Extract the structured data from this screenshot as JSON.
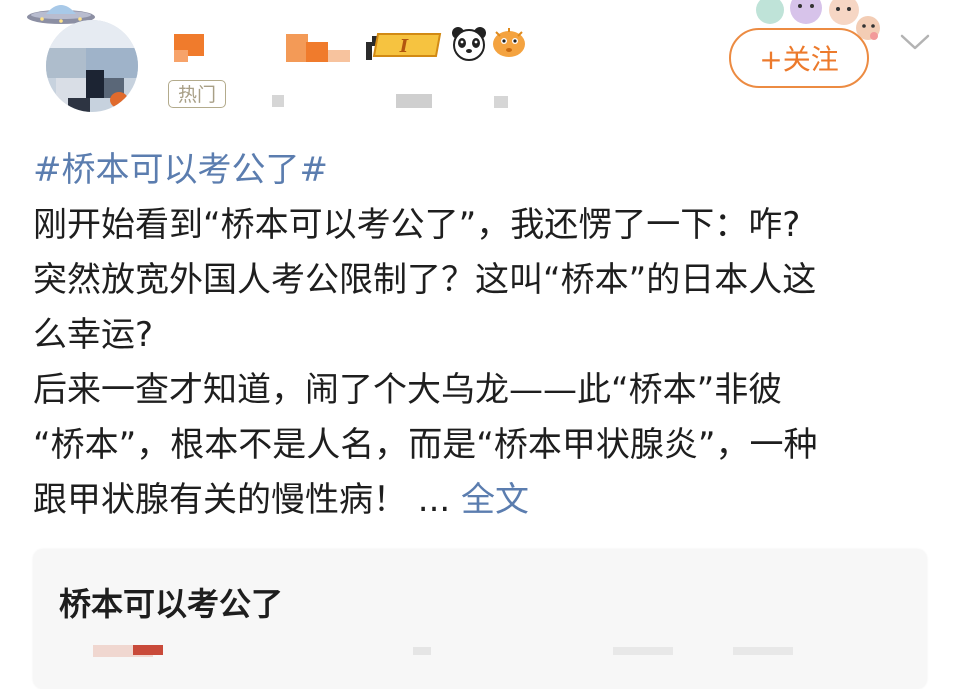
{
  "header": {
    "hot_tag": "热门",
    "follow_label": "+关注",
    "vip_badge_text": "I",
    "icons": {
      "ufo": "ufo-decoration-icon",
      "vip": "vip-level-badge-icon",
      "panda": "panda-icon",
      "fish": "pufferfish-icon",
      "bears": "bear-decoration-icon",
      "chevron": "chevron-down-icon"
    }
  },
  "post": {
    "lines": [
      [
        {
          "type": "hashtag",
          "text": "#桥本可以考公了#"
        }
      ],
      [
        {
          "type": "text",
          "text": "刚开始看到“桥本可以考公了”，我还愣了一下：咋?"
        }
      ],
      [
        {
          "type": "text",
          "text": "突然放宽外国人考公限制了？这叫“桥本”的日本人这"
        }
      ],
      [
        {
          "type": "text",
          "text": "么幸运?"
        }
      ],
      [
        {
          "type": "text",
          "text": "后来一查才知道，闹了个大乌龙——此“桥本”非彼"
        }
      ],
      [
        {
          "type": "text",
          "text": "“桥本”，根本不是人名，而是“桥本甲状腺炎”，一种"
        }
      ],
      [
        {
          "type": "text",
          "text": "跟甲状腺有关的慢性病！"
        },
        {
          "type": "ellipsis",
          "text": " ... "
        },
        {
          "type": "link",
          "text": "全文"
        }
      ]
    ]
  },
  "card": {
    "title": "桥本可以考公了"
  },
  "colors": {
    "link": "#5b7daf",
    "follow_orange": "#ec7a2c",
    "tag_border": "#b3ab8c"
  }
}
